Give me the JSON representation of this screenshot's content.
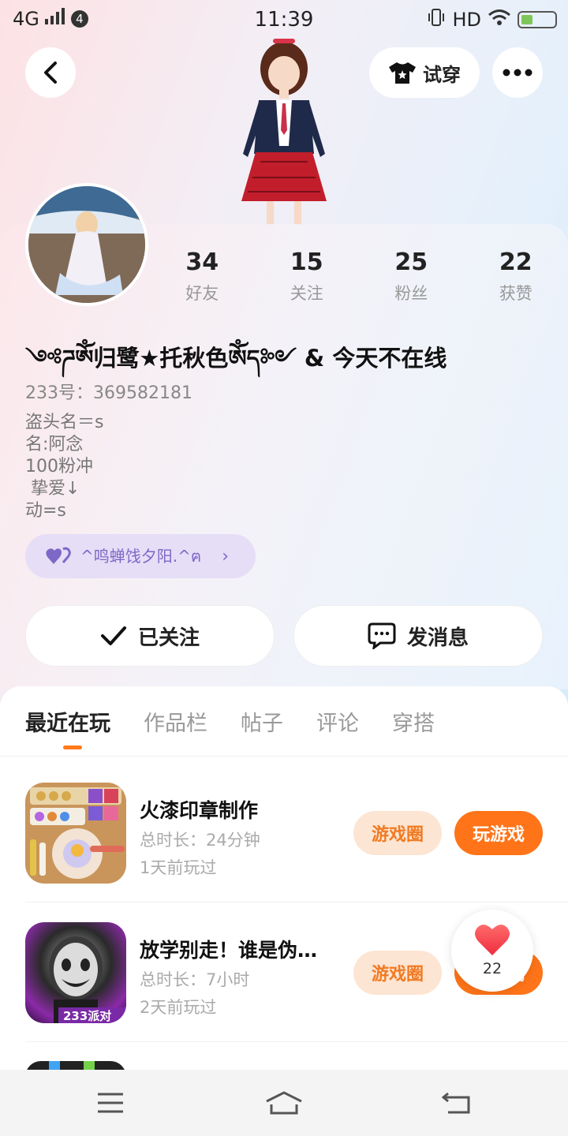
{
  "status_bar": {
    "network": "4G",
    "badge_count": "4",
    "time": "11:39",
    "hd": "HD"
  },
  "header": {
    "try_on_label": "试穿"
  },
  "profile": {
    "stats": [
      {
        "value": "34",
        "label": "好友"
      },
      {
        "value": "15",
        "label": "关注"
      },
      {
        "value": "25",
        "label": "粉丝"
      },
      {
        "value": "22",
        "label": "获赞"
      }
    ],
    "nickname": "༺ཌༀ归鹭★托秋色ༀད༻ & 今天不在线",
    "uid": "233号：369582181",
    "bio_lines": [
      "盗头名＝s",
      "名:阿念",
      "100粉冲",
      " 挚爱↓",
      "动=s"
    ],
    "pair_tag": "^鸣蝉饯夕阳.^ฅ",
    "follow_label": "已关注",
    "message_label": "发消息"
  },
  "tabs": [
    "最近在玩",
    "作品栏",
    "帖子",
    "评论",
    "穿搭"
  ],
  "games": [
    {
      "name": "火漆印章制作",
      "duration": "总时长：24分钟",
      "last_played": "1天前玩过",
      "circle_label": "游戏圈",
      "play_label": "玩游戏"
    },
    {
      "name": "放学别走！谁是伪…",
      "duration": "总时长：7小时",
      "last_played": "2天前玩过",
      "circle_label": "游戏圈",
      "play_label": "玩游戏",
      "icon_text": "233派对"
    }
  ],
  "like_float": {
    "count": "22"
  },
  "colors": {
    "accent": "#ff7418",
    "accent_light": "#fde5d3",
    "tag_purple": "#7d68c8",
    "tag_bg": "#e6def6"
  }
}
